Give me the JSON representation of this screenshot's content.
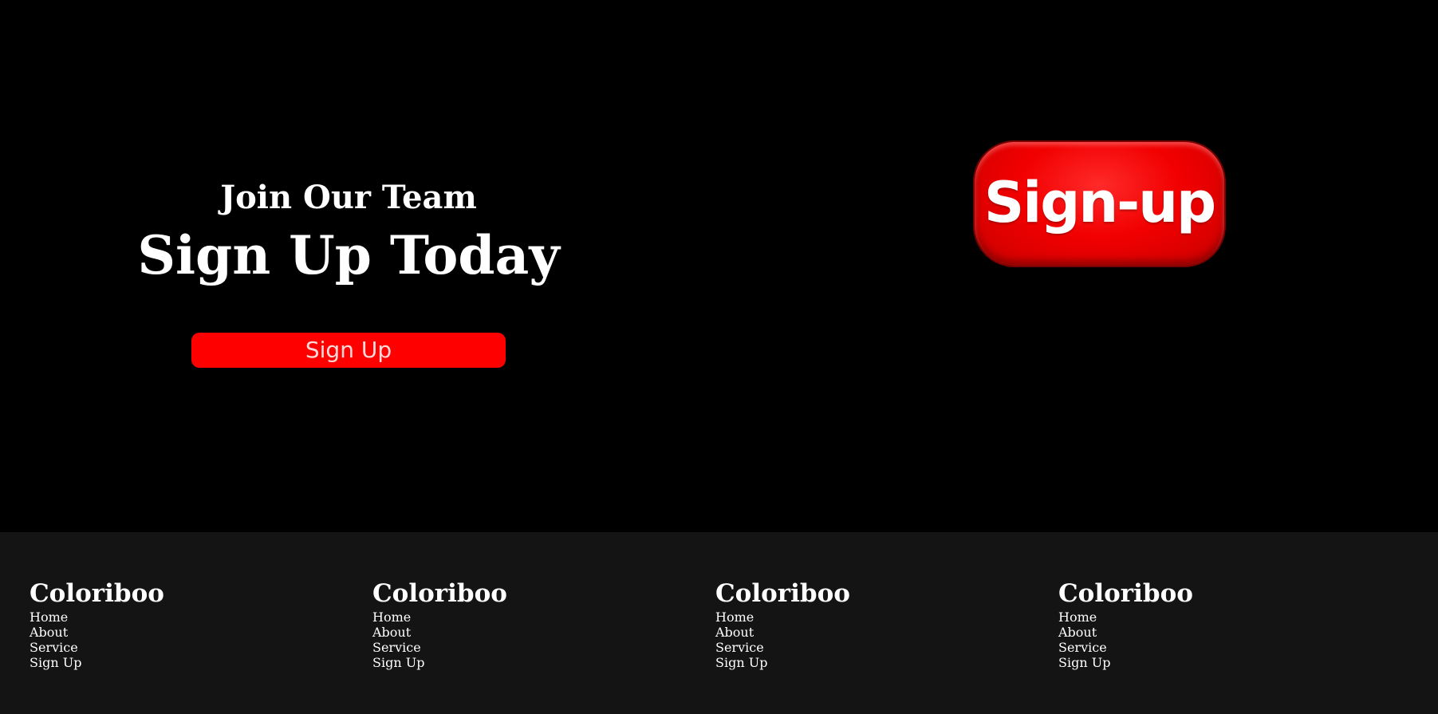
{
  "hero": {
    "kicker": "Join Our Team",
    "headline": "Sign Up Today",
    "button_label": "Sign Up",
    "graphic_text": "Sign-up"
  },
  "colors": {
    "background": "#000000",
    "accent": "#ff0000",
    "footer_background": "#141414",
    "text": "#ffffff"
  },
  "footer": {
    "columns": [
      {
        "brand": "Coloriboo",
        "links": [
          "Home",
          "About",
          "Service",
          "Sign Up"
        ]
      },
      {
        "brand": "Coloriboo",
        "links": [
          "Home",
          "About",
          "Service",
          "Sign Up"
        ]
      },
      {
        "brand": "Coloriboo",
        "links": [
          "Home",
          "About",
          "Service",
          "Sign Up"
        ]
      },
      {
        "brand": "Coloriboo",
        "links": [
          "Home",
          "About",
          "Service",
          "Sign Up"
        ]
      }
    ]
  }
}
